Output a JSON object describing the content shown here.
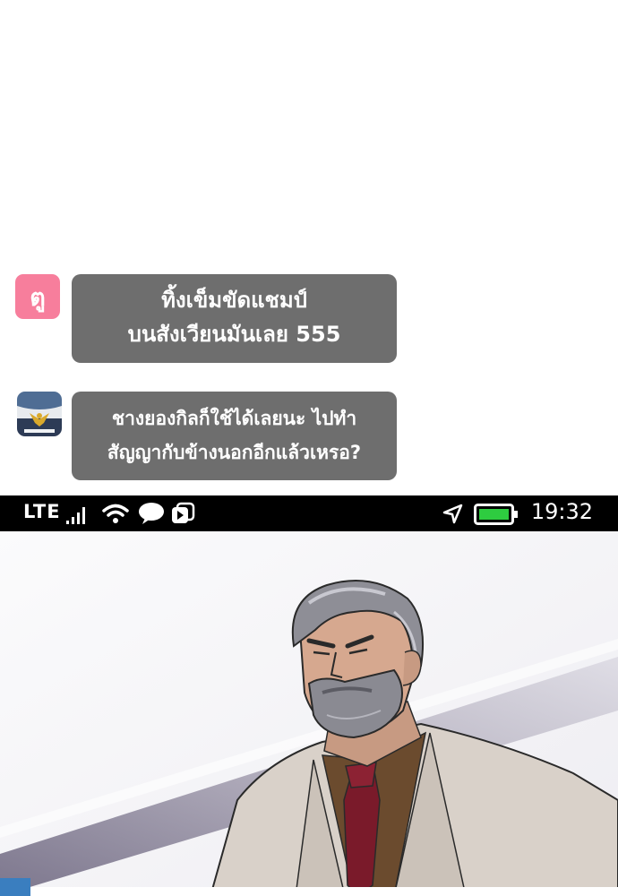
{
  "chat": {
    "messages": [
      {
        "avatar_icon": "pink-letter-avatar-icon",
        "avatar_glyph": "ตู",
        "avatar_color": "#f77e9c",
        "bubble_color": "#6e6e6e",
        "lines": [
          "ทิ้งเข็มขัดแชมป์",
          "บนสังเวียนมันเลย 555"
        ]
      },
      {
        "avatar_icon": "eagle-emblem-avatar-icon",
        "bubble_color": "#6e6e6e",
        "lines": [
          "ชางยองกิลก็ใช้ได้เลยนะ ไปทำ",
          "สัญญากับข้างนอกอีกแล้วเหรอ?"
        ]
      }
    ]
  },
  "status_bar": {
    "network": "LTE",
    "time": "19:32",
    "icons": [
      "signal-icon",
      "wifi-icon",
      "chat-icon",
      "media-icon",
      "location-icon",
      "battery-icon"
    ],
    "battery_color": "#2ecc40"
  },
  "scene": {
    "subject": "gray-bearded-man-illustration",
    "tie_color": "#7a1a2a",
    "jacket_color": "#d8d0c8"
  }
}
